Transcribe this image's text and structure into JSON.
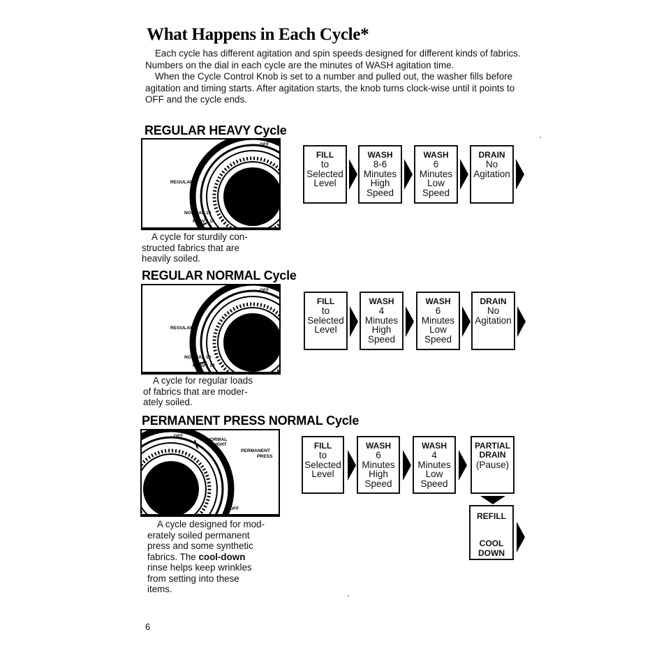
{
  "page": {
    "title": "What Happens in Each Cycle*",
    "intro": [
      "Each cycle has different agitation and spin speeds designed for different kinds of fabrics. Numbers on the dial in each cycle are the minutes of WASH agitation time.",
      "When the Cycle Control Knob is set to a number and pulled out, the washer fills before agitation and timing starts. After agitation starts, the knob turns clock-wise until it points to OFF and the cycle ends."
    ],
    "page_number": "6"
  },
  "sections": [
    {
      "heading_caps": "REGULAR HEAVY",
      "heading_suffix": "Cycle",
      "dial": {
        "off": "OFF",
        "cycle": "REGULAR",
        "setting1": "NORMAL 10",
        "setting2": "HEAVY 14"
      },
      "description": [
        "A cycle for sturdily con-",
        "structed fabrics that are",
        "heavily soiled."
      ],
      "steps": [
        {
          "lines": [
            "FILL",
            "to",
            "Selected",
            "Level"
          ]
        },
        {
          "lines": [
            "WASH",
            "8-6",
            "Minutes",
            "High",
            "Speed"
          ]
        },
        {
          "lines": [
            "WASH",
            "6",
            "Minutes",
            "Low",
            "Speed"
          ]
        },
        {
          "lines": [
            "DRAIN",
            "No",
            "Agitation"
          ]
        }
      ]
    },
    {
      "heading_caps": "REGULAR NORMAL",
      "heading_suffix": "Cycle",
      "dial": {
        "off": "OFF",
        "cycle": "REGULAR",
        "setting1": "NORMAL 10",
        "setting2": "HEAVY 14"
      },
      "description": [
        "A cycle for regular loads",
        "of fabrics that are moder-",
        "ately soiled."
      ],
      "steps": [
        {
          "lines": [
            "FILL",
            "to",
            "Selected",
            "Level"
          ]
        },
        {
          "lines": [
            "WASH",
            "4",
            "Minutes",
            "High",
            "Speed"
          ]
        },
        {
          "lines": [
            "WASH",
            "6",
            "Minutes",
            "Low",
            "Speed"
          ]
        },
        {
          "lines": [
            "DRAIN",
            "No",
            "Agitation"
          ]
        }
      ]
    },
    {
      "heading_caps": "PERMANENT PRESS NORMAL",
      "heading_suffix": "Cycle",
      "dial": {
        "off_top": "OFF",
        "setting1": "10 NORMAL",
        "setting2": "6 LIGHT",
        "cycle_line1": "PERMANENT",
        "cycle_line2": "PRESS",
        "off_bottom": "OFF"
      },
      "description_before_bold": "A cycle designed for mod- erately soiled permanent press and some synthetic fabrics. The ",
      "description_bold": "cool-down",
      "description_after_bold": " rinse helps keep wrinkles from setting into these items.",
      "description_lines": [
        "A cycle designed for mod-",
        "erately soiled permanent",
        "press and some synthetic",
        "fabrics. The ",
        "cool-down",
        "rinse helps keep wrinkles",
        "from setting into these",
        "items."
      ],
      "steps": [
        {
          "lines": [
            "FILL",
            "to",
            "Selected",
            "Level"
          ]
        },
        {
          "lines": [
            "WASH",
            "6",
            "Minutes",
            "High",
            "Speed"
          ]
        },
        {
          "lines": [
            "WASH",
            "4",
            "Minutes",
            "Low",
            "Speed"
          ]
        },
        {
          "lines": [
            "PARTIAL",
            "DRAIN",
            "(Pause)"
          ]
        },
        {
          "lines": [
            "REFILL",
            "",
            "COOL",
            "DOWN"
          ]
        }
      ]
    }
  ]
}
